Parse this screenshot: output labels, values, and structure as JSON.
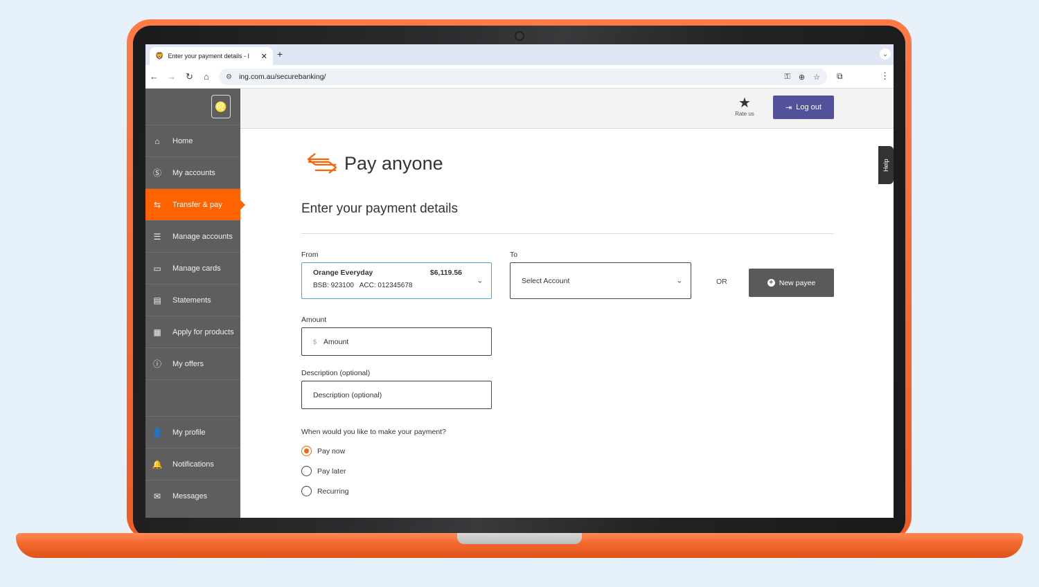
{
  "browser": {
    "tab_title": "Enter your payment details - I",
    "url": "ing.com.au/securebanking/"
  },
  "sidebar": {
    "items": [
      {
        "label": "Home",
        "icon": "home-icon"
      },
      {
        "label": "My accounts",
        "icon": "dollar-icon"
      },
      {
        "label": "Transfer & pay",
        "icon": "transfer-icon",
        "active": true
      },
      {
        "label": "Manage accounts",
        "icon": "sliders-icon"
      },
      {
        "label": "Manage cards",
        "icon": "card-icon"
      },
      {
        "label": "Statements",
        "icon": "document-icon"
      },
      {
        "label": "Apply for products",
        "icon": "grid-icon"
      },
      {
        "label": "My offers",
        "icon": "alert-icon"
      }
    ],
    "bottom_items": [
      {
        "label": "My profile",
        "icon": "person-icon"
      },
      {
        "label": "Notifications",
        "icon": "bell-icon"
      },
      {
        "label": "Messages",
        "icon": "envelope-icon"
      }
    ]
  },
  "topbar": {
    "rate_label": "Rate us",
    "logout_label": "Log out"
  },
  "help_label": "Help",
  "page": {
    "title": "Pay anyone",
    "section_title": "Enter your payment details",
    "from_label": "From",
    "from_account_name": "Orange Everyday",
    "from_account_balance": "$6,119.56",
    "from_account_details": "BSB: 923100   ACC: 012345678",
    "to_label": "To",
    "to_placeholder": "Select Account",
    "or_label": "OR",
    "new_payee_label": "New payee",
    "amount_label": "Amount",
    "amount_currency": "$",
    "amount_placeholder": "Amount",
    "description_label": "Description (optional)",
    "description_placeholder": "Description (optional)",
    "when_label": "When would you like to make your payment?",
    "options": [
      "Pay now",
      "Pay later",
      "Recurring"
    ],
    "selected_option": "Pay now"
  },
  "colors": {
    "accent": "#ff6200",
    "sidebar": "#5e5e5e",
    "logout": "#525199"
  }
}
